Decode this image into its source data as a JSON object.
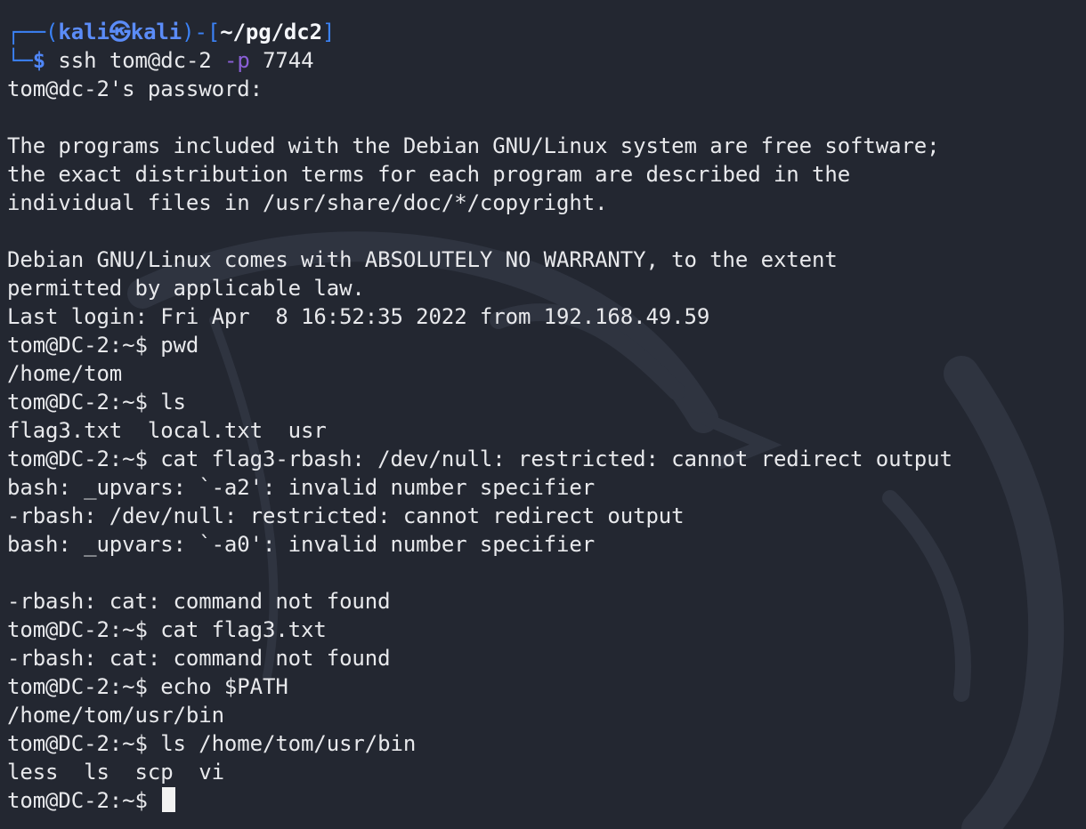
{
  "prompt": {
    "box_open": "┌──(",
    "user": "kali",
    "at_symbol": "㉿",
    "host": "kali",
    "mid": ")-[",
    "cwd": "~/pg/dc2",
    "close": "]",
    "corner": "└─",
    "dollar": "$",
    "cmd_name": "ssh",
    "cmd_target": "tom@dc-2",
    "cmd_flag": "-p",
    "cmd_port": "7744"
  },
  "output": [
    "tom@dc-2's password:",
    "",
    "The programs included with the Debian GNU/Linux system are free software;",
    "the exact distribution terms for each program are described in the",
    "individual files in /usr/share/doc/*/copyright.",
    "",
    "Debian GNU/Linux comes with ABSOLUTELY NO WARRANTY, to the extent",
    "permitted by applicable law.",
    "Last login: Fri Apr  8 16:52:35 2022 from 192.168.49.59",
    "tom@DC-2:~$ pwd",
    "/home/tom",
    "tom@DC-2:~$ ls",
    "flag3.txt  local.txt  usr",
    "tom@DC-2:~$ cat flag3-rbash: /dev/null: restricted: cannot redirect output",
    "bash: _upvars: `-a2': invalid number specifier",
    "-rbash: /dev/null: restricted: cannot redirect output",
    "bash: _upvars: `-a0': invalid number specifier",
    "",
    "-rbash: cat: command not found",
    "tom@DC-2:~$ cat flag3.txt",
    "-rbash: cat: command not found",
    "tom@DC-2:~$ echo $PATH",
    "/home/tom/usr/bin",
    "tom@DC-2:~$ ls /home/tom/usr/bin",
    "less  ls  scp  vi"
  ],
  "final_prompt": "tom@DC-2:~$ ",
  "colors": {
    "background": "#232731",
    "foreground": "#e8e9ec",
    "prompt_blue": "#4f86f7",
    "flag_purple": "#8a5fd6",
    "cursor": "#f2f2f2"
  },
  "icons": {
    "watermark": "kali-dragon-watermark-icon",
    "cursor": "block-cursor-icon"
  }
}
